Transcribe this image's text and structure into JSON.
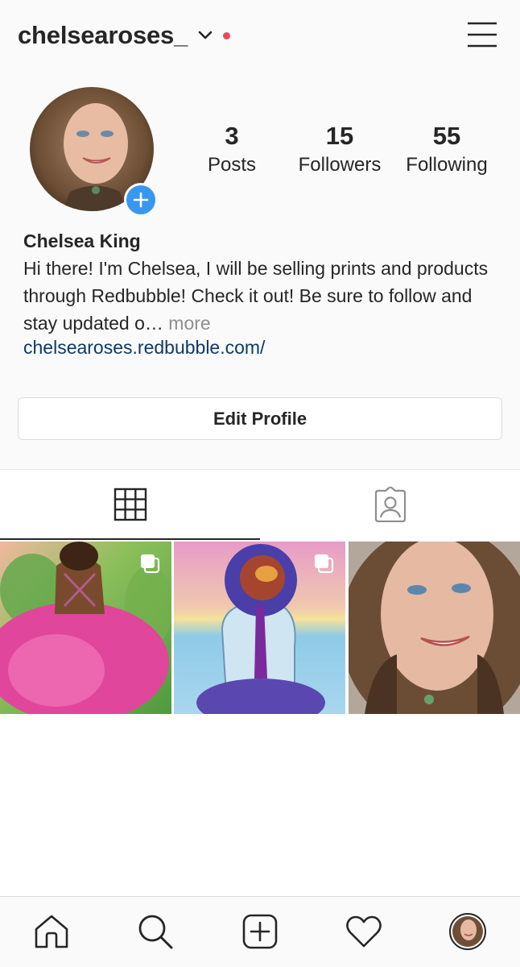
{
  "header": {
    "username": "chelsearoses_",
    "notification_dot_color": "#ed4956"
  },
  "profile": {
    "stats": {
      "posts_count": "3",
      "posts_label": "Posts",
      "followers_count": "15",
      "followers_label": "Followers",
      "following_count": "55",
      "following_label": "Following"
    },
    "full_name": "Chelsea King",
    "bio": "Hi there! I'm Chelsea, I will be selling prints and products through Redbubble! Check it out! Be sure to follow and stay updated o…",
    "bio_more": "more",
    "website": "chelsearoses.redbubble.com/",
    "edit_profile_label": "Edit Profile",
    "add_story_color": "#3897f0"
  },
  "tabs": {
    "active": "grid",
    "items": [
      {
        "name": "grid",
        "icon": "grid-icon"
      },
      {
        "name": "tagged",
        "icon": "tagged-person-icon"
      }
    ]
  },
  "posts": [
    {
      "subject": "watercolor painting of woman in pink gown",
      "multi": true
    },
    {
      "subject": "watercolor painting of figure by the sea",
      "multi": true
    },
    {
      "subject": "selfie portrait photo",
      "multi": false
    }
  ],
  "bottom_nav": [
    {
      "name": "home",
      "icon": "home-icon"
    },
    {
      "name": "search",
      "icon": "search-icon"
    },
    {
      "name": "new-post",
      "icon": "plus-square-icon"
    },
    {
      "name": "activity",
      "icon": "heart-icon"
    },
    {
      "name": "profile",
      "icon": "profile-avatar-icon"
    }
  ]
}
